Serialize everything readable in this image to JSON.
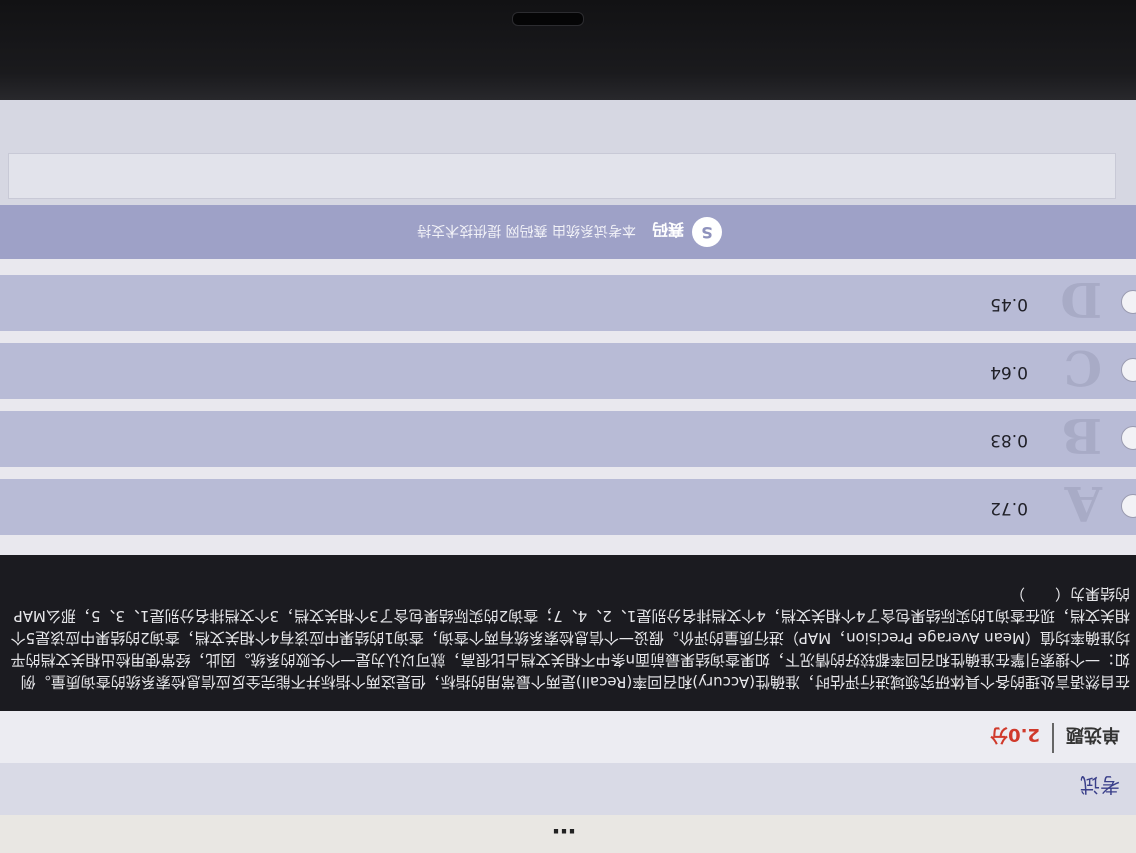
{
  "exam": {
    "title_fragment": "…",
    "nav_label": "考试"
  },
  "question": {
    "type": "单选题",
    "score": "2.0分",
    "text": "在自然语言处理的各个具体研究领域进行评估时，准确性(Accury)和召回率(Recall)是两个最常用的指标，但是这两个指标并不能完全反应信息检索系统的查询质量。例如：一个搜索引擎在准确性和召回率都较好的情况下，如果查询结果最前面n条中不相关文档占比很高，就可以认为是一个失败的系统。因此，经常使用检出相关文档的平均准确率均值（Mean Average Precision，MAP）进行质量的评价。假设一个信息检索系统有两个查询，查询1的结果中应该有4个相关文档，查询2的结果中应该是5个相关文档，现在查询1的实际结果包含了4个相关文档，4个文档排名分别是1、2、4、7；查询2的实际结果包含了3个相关文档，3个文档排名分别是1、3、5，那么MAP的结果为（　　）"
  },
  "options": [
    {
      "letter": "A",
      "value": "0.72"
    },
    {
      "letter": "B",
      "value": "0.83"
    },
    {
      "letter": "C",
      "value": "0.64"
    },
    {
      "letter": "D",
      "value": "0.45"
    }
  ],
  "footer": {
    "logo": "S",
    "brand": "赛码",
    "text": "本考试系统由 赛码网 提供技术支持"
  },
  "colors": {
    "option_bg": "#b8bbd6",
    "footer_bg": "#9ea1c7",
    "question_bg": "#1b1b20",
    "score_red": "#d0392b"
  }
}
